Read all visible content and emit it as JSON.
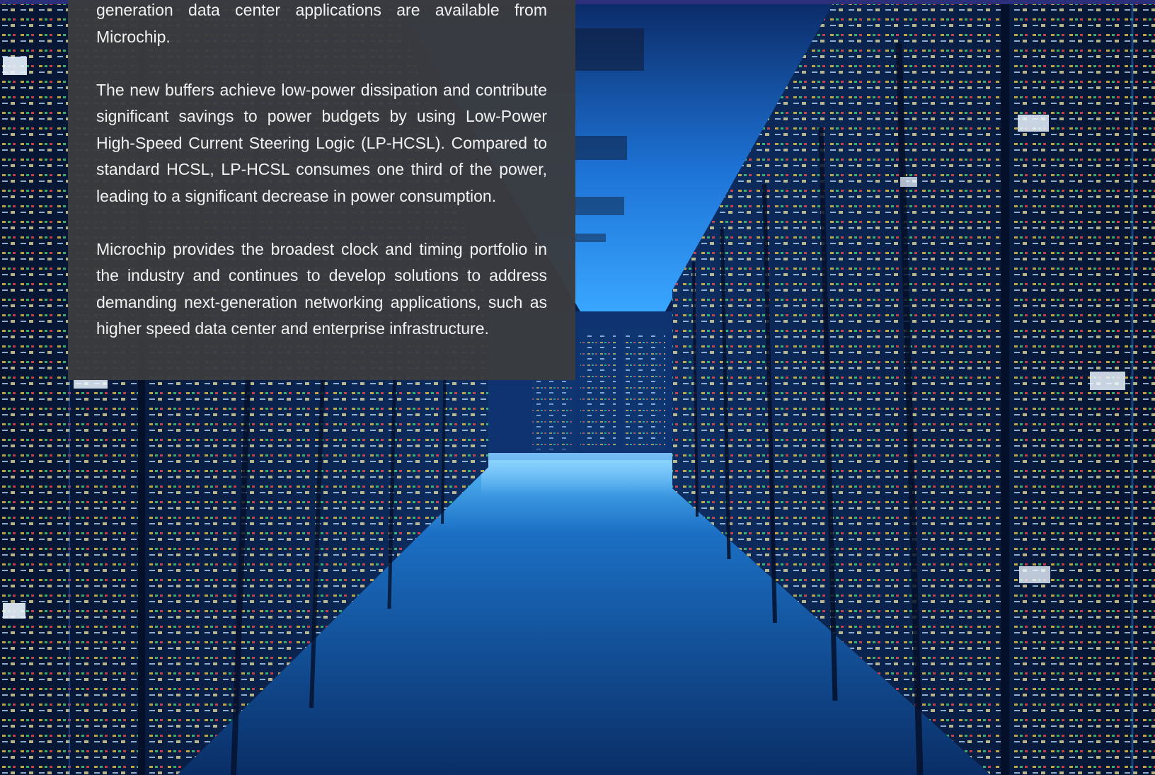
{
  "article": {
    "paragraphs": [
      "generation data center applications are available from Microchip.",
      "The new buffers achieve low-power dissipation and contribute significant savings to power budgets by using Low-Power High-Speed Current Steering Logic (LP-HCSL). Compared to standard HCSL, LP-HCSL consumes one third of the power, leading to a significant decrease in power consumption.",
      "Microchip provides the broadest clock and timing portfolio in the industry and continues to develop solutions to address demanding next-generation networking applications, such as higher speed data center and enterprise infrastructure."
    ]
  },
  "colors": {
    "panel": "#3a3b3e",
    "text": "#f2f2f2",
    "background_blue": "#1565c0",
    "top_strip": "#2c2f7a"
  }
}
